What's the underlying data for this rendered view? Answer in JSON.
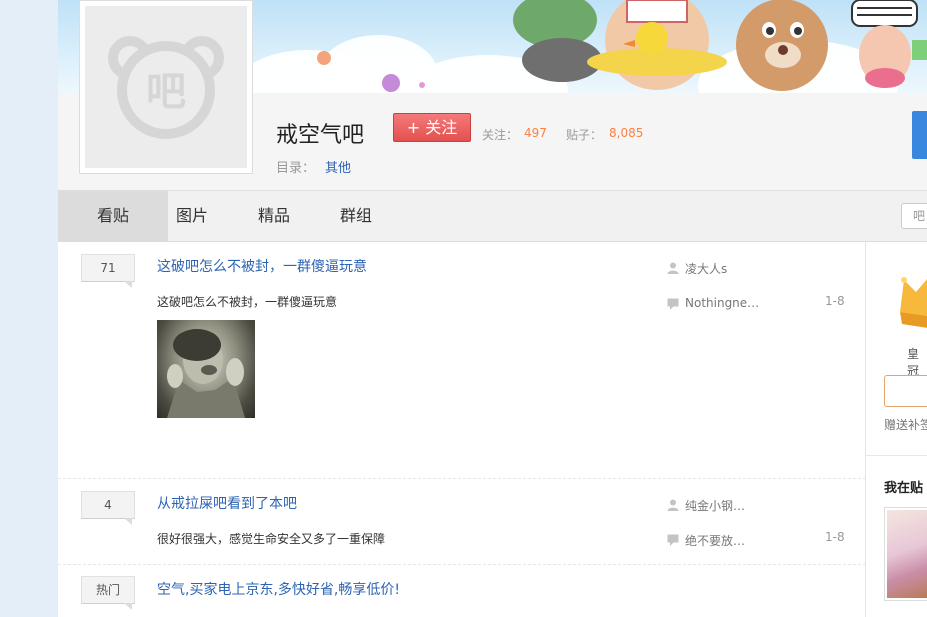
{
  "forum": {
    "name": "戒空气吧",
    "follow_label": "+ 关注",
    "follow_count_label": "关注：",
    "follow_count": "497",
    "post_count_label": "贴子：",
    "post_count": "8,085",
    "directory_label": "目录：",
    "directory_value": "其他",
    "avatar_text": "吧"
  },
  "tabs": [
    {
      "label": "看贴",
      "active": true
    },
    {
      "label": "图片",
      "active": false
    },
    {
      "label": "精品",
      "active": false
    },
    {
      "label": "群组",
      "active": false
    }
  ],
  "search": {
    "placeholder": "吧"
  },
  "threads": [
    {
      "reply_count": "71",
      "title": "这破吧怎么不被封，一群傻逼玩意",
      "abstract": "这破吧怎么不被封，一群傻逼玩意",
      "author": "凌大人s",
      "last_replier": "Nothingne…",
      "last_time": "1-8"
    },
    {
      "reply_count": "4",
      "title": "从戒拉屎吧看到了本吧",
      "abstract": "很好很强大，感觉生命安全又多了一重保障",
      "author": "纯金小钢…",
      "last_replier": "绝不要放…",
      "last_time": "1-8"
    },
    {
      "reply_count": "热门",
      "title": "空气,买家电上京东,多快好省,畅享低价!"
    }
  ],
  "aside": {
    "crown_label": "皇冠",
    "gift_note": "赠送补签",
    "section_title": "我在贴"
  },
  "colors": {
    "link": "#2d64b3",
    "follow_button": "#e2514f",
    "stat_value": "#ff7f3e",
    "accent_blue": "#3a87e0"
  }
}
